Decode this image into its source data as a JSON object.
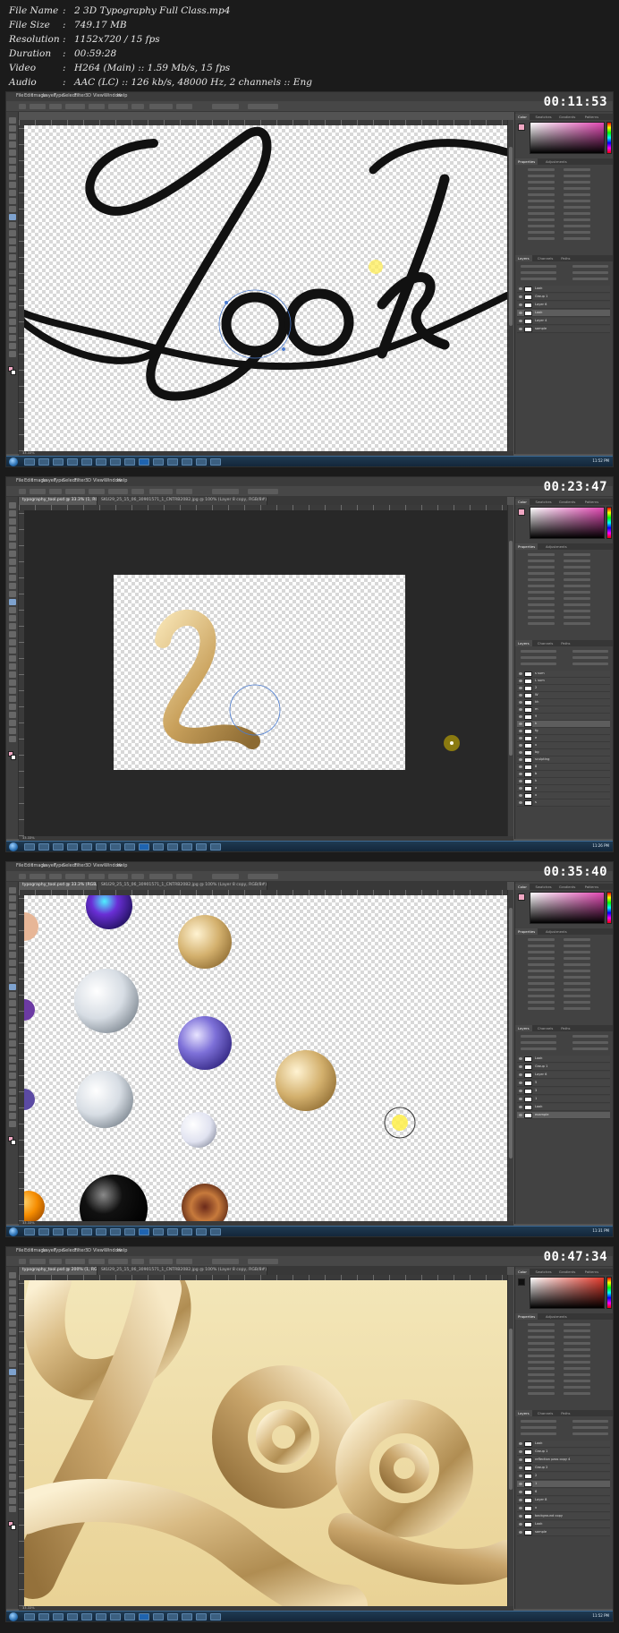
{
  "file_info": [
    {
      "key": "File Name",
      "value": "2 3D Typography Full Class.mp4"
    },
    {
      "key": "File Size",
      "value": "749.17 MB"
    },
    {
      "key": "Resolution",
      "value": "1152x720 / 15 fps"
    },
    {
      "key": "Duration",
      "value": "00:59:28"
    },
    {
      "key": "Video",
      "value": "H264 (Main) :: 1.59 Mb/s, 15 fps"
    },
    {
      "key": "Audio",
      "value": "AAC (LC) :: 126 kb/s, 48000 Hz, 2 channels :: Eng"
    }
  ],
  "menus": [
    "File",
    "Edit",
    "Image",
    "Layer",
    "Type",
    "Select",
    "Filter",
    "3D",
    "View",
    "Window",
    "Help"
  ],
  "frames": [
    {
      "timestamp": "00:11:53",
      "tabs": [],
      "status": "33.33%",
      "clock": "11:52 PM",
      "panel_tabs": [
        "Color",
        "Swatches",
        "Gradients",
        "Patterns"
      ],
      "properties_tabs": [
        "Properties",
        "Adjustments"
      ],
      "layer_tabs": [
        "Layers",
        "Channels",
        "Paths"
      ],
      "layers": [
        "Look",
        "Group 1",
        "Layer 6",
        "Look",
        "Layer 4",
        "sample"
      ],
      "selected_layer": 3
    },
    {
      "timestamp": "00:23:47",
      "tabs": [
        "typography_tool.psd @ 33.3% (1, RGB/8) *",
        "SKU29_25_15_06_30901571_1_CNTRB2082.jpg @ 100% (Layer 8 copy, RGB/8#)"
      ],
      "status": "33.33%",
      "clock": "11:26 PM",
      "panel_tabs": [
        "Color",
        "Swatches",
        "Gradients",
        "Patterns"
      ],
      "properties_tabs": [
        "Properties",
        "Adjustments"
      ],
      "layer_tabs": [
        "Layers",
        "Channels",
        "Paths"
      ],
      "layers": [
        "s sum",
        "L sum",
        "2",
        "W",
        "kh",
        "m",
        "9",
        "k",
        "fg",
        "e",
        "x",
        "bg",
        "sculpting",
        "8",
        "b",
        "k",
        "a",
        "x",
        "s"
      ],
      "selected_layer": 7
    },
    {
      "timestamp": "00:35:40",
      "tabs": [
        "typography_tool.psd @ 33.3% (RGB/8) *",
        "SKU29_25_15_06_30901571_1_CNTRB2082.jpg @ 100% (Layer 8 copy, RGB/8#)"
      ],
      "status": "33.33%",
      "clock": "11:31 PM",
      "panel_tabs": [
        "Color",
        "Swatches",
        "Gradients",
        "Patterns"
      ],
      "properties_tabs": [
        "Properties",
        "Adjustments"
      ],
      "layer_tabs": [
        "Layers",
        "Channels",
        "Paths"
      ],
      "layers": [
        "Look",
        "Group 1",
        "Layer 6",
        "5",
        "3",
        "1",
        "Look",
        "example"
      ],
      "selected_layer": 7
    },
    {
      "timestamp": "00:47:34",
      "tabs": [
        "typography_tool.psd @ 200% (1, RGB/8) *",
        "SKU29_25_15_06_30901571_1_CNTRB2082.jpg @ 100% (Layer 8 copy, RGB/8#)"
      ],
      "status": "33.33%",
      "clock": "11:52 PM",
      "panel_tabs": [
        "Color",
        "Swatches",
        "Gradients",
        "Patterns"
      ],
      "properties_tabs": [
        "Properties",
        "Adjustments"
      ],
      "layer_tabs": [
        "Layers",
        "Channels",
        "Paths"
      ],
      "layers": [
        "Look",
        "Group 1",
        "reflection pass copy 4",
        "Group 2",
        "2",
        "1",
        "6",
        "Layer 8",
        "x",
        "background copy",
        "Look",
        "sample"
      ],
      "selected_layer": 5
    }
  ],
  "colors": {
    "accent_gold": "#d8b77a",
    "cursor_yellow": "#fff04a",
    "cursor_olive": "#8a7a10",
    "panel_bg": "#424242",
    "workspace": "#535353"
  }
}
